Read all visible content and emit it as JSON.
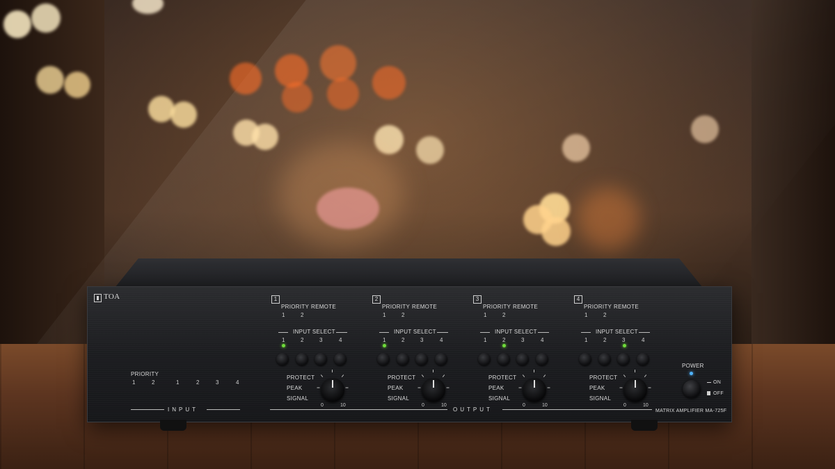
{
  "brand": {
    "logo_text": "TOA"
  },
  "input_section": {
    "priority_label": "PRIORITY",
    "priority_numbers": [
      "1",
      "2"
    ],
    "input_numbers": [
      "1",
      "2",
      "3",
      "4"
    ],
    "input_label": "INPUT"
  },
  "channels": [
    {
      "number": "1",
      "priority_label": "PRIORITY",
      "remote_label": "REMOTE",
      "sub_numbers": [
        "1",
        "2"
      ],
      "input_select_label": "INPUT SELECT",
      "select_numbers": [
        "1",
        "2",
        "3",
        "4"
      ],
      "active_led_index": 0,
      "protect_label": "PROTECT",
      "peak_label": "PEAK",
      "signal_label": "SIGNAL",
      "knob_min": "0",
      "knob_max": "10"
    },
    {
      "number": "2",
      "priority_label": "PRIORITY",
      "remote_label": "REMOTE",
      "sub_numbers": [
        "1",
        "2"
      ],
      "input_select_label": "INPUT SELECT",
      "select_numbers": [
        "1",
        "2",
        "3",
        "4"
      ],
      "active_led_index": 0,
      "protect_label": "PROTECT",
      "peak_label": "PEAK",
      "signal_label": "SIGNAL",
      "knob_min": "0",
      "knob_max": "10"
    },
    {
      "number": "3",
      "priority_label": "PRIORITY",
      "remote_label": "REMOTE",
      "sub_numbers": [
        "1",
        "2"
      ],
      "input_select_label": "INPUT SELECT",
      "select_numbers": [
        "1",
        "2",
        "3",
        "4"
      ],
      "active_led_index": 1,
      "protect_label": "PROTECT",
      "peak_label": "PEAK",
      "signal_label": "SIGNAL",
      "knob_min": "0",
      "knob_max": "10"
    },
    {
      "number": "4",
      "priority_label": "PRIORITY",
      "remote_label": "REMOTE",
      "sub_numbers": [
        "1",
        "2"
      ],
      "input_select_label": "INPUT SELECT",
      "select_numbers": [
        "1",
        "2",
        "3",
        "4"
      ],
      "active_led_index": 2,
      "protect_label": "PROTECT",
      "peak_label": "PEAK",
      "signal_label": "SIGNAL",
      "knob_min": "0",
      "knob_max": "10"
    }
  ],
  "output_label": "OUTPUT",
  "power": {
    "label": "POWER",
    "on_label": "ON",
    "off_label": "OFF"
  },
  "model_label": "MATRIX AMPLIFIER MA-725F",
  "colors": {
    "led_green": "#6fdc3a",
    "led_blue": "#4fb3ff",
    "panel": "#1c1d20"
  }
}
